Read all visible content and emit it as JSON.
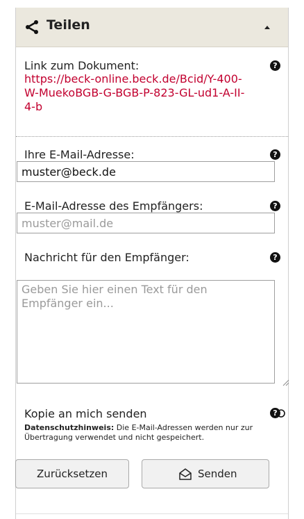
{
  "header": {
    "title": "Teilen",
    "share_icon": "share-icon",
    "collapse_icon": "caret-up-icon"
  },
  "link": {
    "label": "Link zum Dokument:",
    "url": "https://beck-online.beck.de/Bcid/Y-400-W-MuekoBGB-G-BGB-P-823-GL-ud1-A-II-4-b",
    "color": "#c2002f"
  },
  "sender": {
    "label": "Ihre E-Mail-Adresse:",
    "value": "muster@beck.de"
  },
  "recipient": {
    "label": "E-Mail-Adresse des Empfängers:",
    "placeholder": "muster@mail.de"
  },
  "message": {
    "label": "Nachricht für den Empfänger:",
    "placeholder": "Geben Sie hier einen Text für den Empfänger ein..."
  },
  "copy": {
    "label": "Kopie an mich senden",
    "toggle_icon": "toggle-icon"
  },
  "privacy": {
    "title": "Datenschutzhinweis:",
    "text": " Die E-Mail-Adressen werden nur zur Übertragung verwendet und nicht gespeichert."
  },
  "buttons": {
    "reset": "Zurücksetzen",
    "send": "Senden"
  },
  "help_icon": "?"
}
